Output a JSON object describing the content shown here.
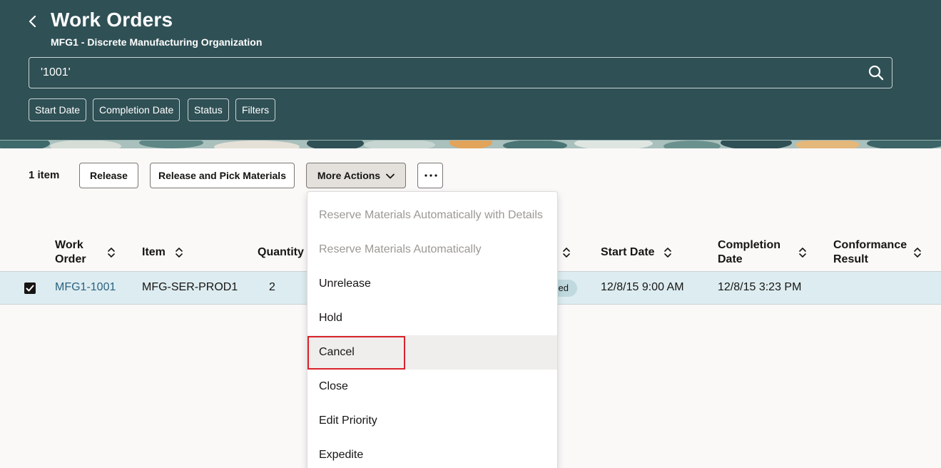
{
  "header": {
    "title": "Work Orders",
    "subtitle": "MFG1 - Discrete Manufacturing Organization",
    "search_value": "'1001'",
    "filters": [
      "Start Date",
      "Completion Date",
      "Status",
      "Filters"
    ]
  },
  "toolbar": {
    "count": "1 item",
    "release_label": "Release",
    "release_pick_label": "Release and Pick Materials",
    "more_actions_label": "More Actions",
    "overflow_label": "..."
  },
  "table": {
    "columns": {
      "work_order": [
        "Work",
        "Order"
      ],
      "item": "Item",
      "quantity": "Quantity",
      "start_date": "Start Date",
      "completion_date": [
        "Completion",
        "Date"
      ],
      "conformance": [
        "Conformance",
        "Result"
      ]
    },
    "row": {
      "work_order": "MFG1-1001",
      "item": "MFG-SER-PROD1",
      "quantity": "2",
      "status_partial": "ed",
      "start_date": "12/8/15 9:00 AM",
      "completion_date": "12/8/15 3:23 PM"
    }
  },
  "menu": {
    "items": [
      {
        "label": "Reserve Materials Automatically with Details",
        "disabled": true
      },
      {
        "label": "Reserve Materials Automatically",
        "disabled": true
      },
      {
        "label": "Unrelease",
        "disabled": false
      },
      {
        "label": "Hold",
        "disabled": false
      },
      {
        "label": "Cancel",
        "disabled": false
      },
      {
        "label": "Close",
        "disabled": false
      },
      {
        "label": "Edit Priority",
        "disabled": false
      },
      {
        "label": "Expedite",
        "disabled": false
      }
    ]
  },
  "colors": {
    "header_bg": "#2f5055",
    "row_selected": "#ddecf0",
    "link": "#2b6382",
    "highlight": "#d9232b"
  }
}
